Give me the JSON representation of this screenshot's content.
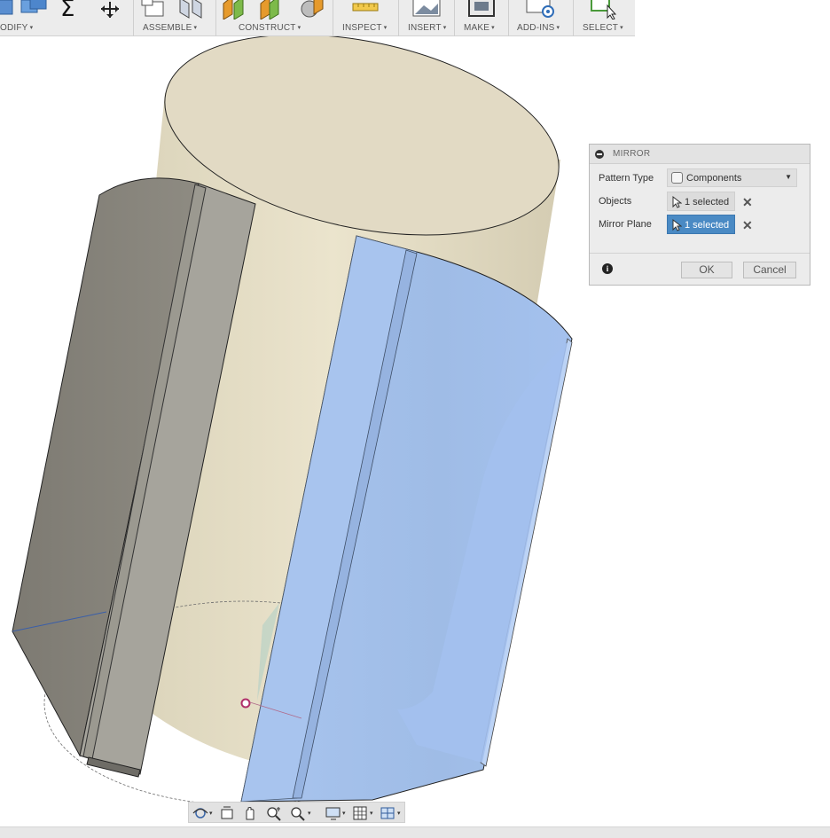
{
  "toolbar": {
    "groups": [
      {
        "label": "ODIFY"
      },
      {
        "label": "ASSEMBLE"
      },
      {
        "label": "CONSTRUCT"
      },
      {
        "label": "INSPECT"
      },
      {
        "label": "INSERT"
      },
      {
        "label": "MAKE"
      },
      {
        "label": "ADD-INS"
      },
      {
        "label": "SELECT"
      }
    ],
    "caret": "▾"
  },
  "dialog": {
    "title": "MIRROR",
    "pattern_type_label": "Pattern Type",
    "pattern_type_value": "Components",
    "objects_label": "Objects",
    "objects_value": "1 selected",
    "mirror_plane_label": "Mirror Plane",
    "mirror_plane_value": "1 selected",
    "clear_symbol": "✕",
    "info_symbol": "i",
    "ok_label": "OK",
    "cancel_label": "Cancel",
    "active_field": "mirror_plane"
  },
  "navbar": {
    "icons": [
      "orbit-icon",
      "look-at-icon",
      "pan-icon",
      "zoom-icon",
      "fit-icon",
      "display-settings-icon",
      "grid-icon",
      "viewports-icon"
    ],
    "caret": "▾"
  },
  "colors": {
    "selection_blue": "#4a8ac4",
    "body_tan": "#e6dfc8",
    "mirror_preview": "#a6c3ec"
  }
}
